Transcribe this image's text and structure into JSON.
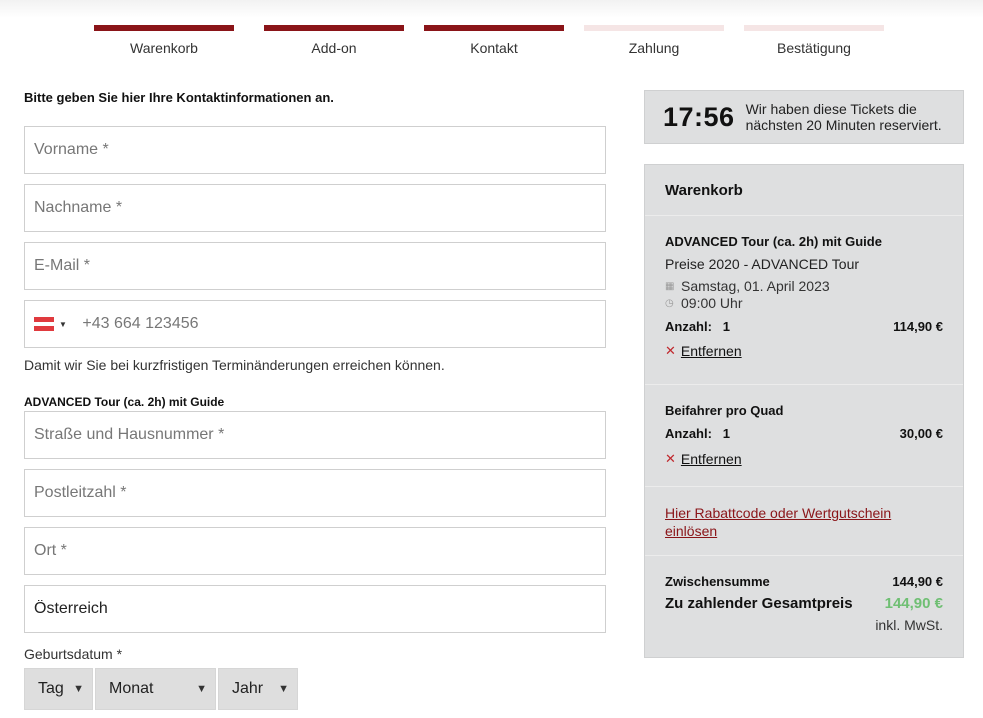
{
  "steps": [
    {
      "label": "Warenkorb",
      "state": "done"
    },
    {
      "label": "Add-on",
      "state": "done"
    },
    {
      "label": "Kontakt",
      "state": "active"
    },
    {
      "label": "Zahlung",
      "state": "pending"
    },
    {
      "label": "Bestätigung",
      "state": "pending"
    }
  ],
  "form": {
    "intro": "Bitte geben Sie hier Ihre Kontaktinformationen an.",
    "first_name_placeholder": "Vorname *",
    "last_name_placeholder": "Nachname *",
    "email_placeholder": "E-Mail *",
    "phone_placeholder": "+43 664 123456",
    "phone_country_icon": "austria-flag-icon",
    "phone_hint": "Damit wir Sie bei kurzfristigen Terminänderungen erreichen können.",
    "section_title": "ADVANCED Tour (ca. 2h) mit Guide",
    "street_placeholder": "Straße und Hausnummer *",
    "zip_placeholder": "Postleitzahl *",
    "city_placeholder": "Ort *",
    "country_value": "Österreich",
    "dob_label": "Geburtsdatum *",
    "dob_day": "Tag",
    "dob_month": "Monat",
    "dob_year": "Jahr"
  },
  "timer": {
    "time": "17:56",
    "message_line1": "Wir haben diese Tickets die",
    "message_line2": "nächsten 20 Minuten reserviert."
  },
  "cart": {
    "title": "Warenkorb",
    "items": [
      {
        "title": "ADVANCED Tour (ca. 2h) mit Guide",
        "subtitle": "Preise 2020 - ADVANCED Tour",
        "date": "Samstag, 01. April 2023",
        "time": "09:00 Uhr",
        "qty_label": "Anzahl:",
        "qty": "1",
        "price": "114,90 €",
        "remove_label": "Entfernen"
      },
      {
        "title": "Beifahrer pro Quad",
        "qty_label": "Anzahl:",
        "qty": "1",
        "price": "30,00 €",
        "remove_label": "Entfernen"
      }
    ],
    "promo_line1": "Hier Rabattcode oder Wertgutschein",
    "promo_line2": "einlösen",
    "subtotal_label": "Zwischensumme",
    "subtotal_value": "144,90 €",
    "total_label": "Zu zahlender Gesamtpreis",
    "total_value": "144,90 €",
    "vat_note": "inkl. MwSt.",
    "colors": {
      "accent": "#8a1418",
      "total": "#6fbf73",
      "remove_x": "#c0282d"
    }
  }
}
